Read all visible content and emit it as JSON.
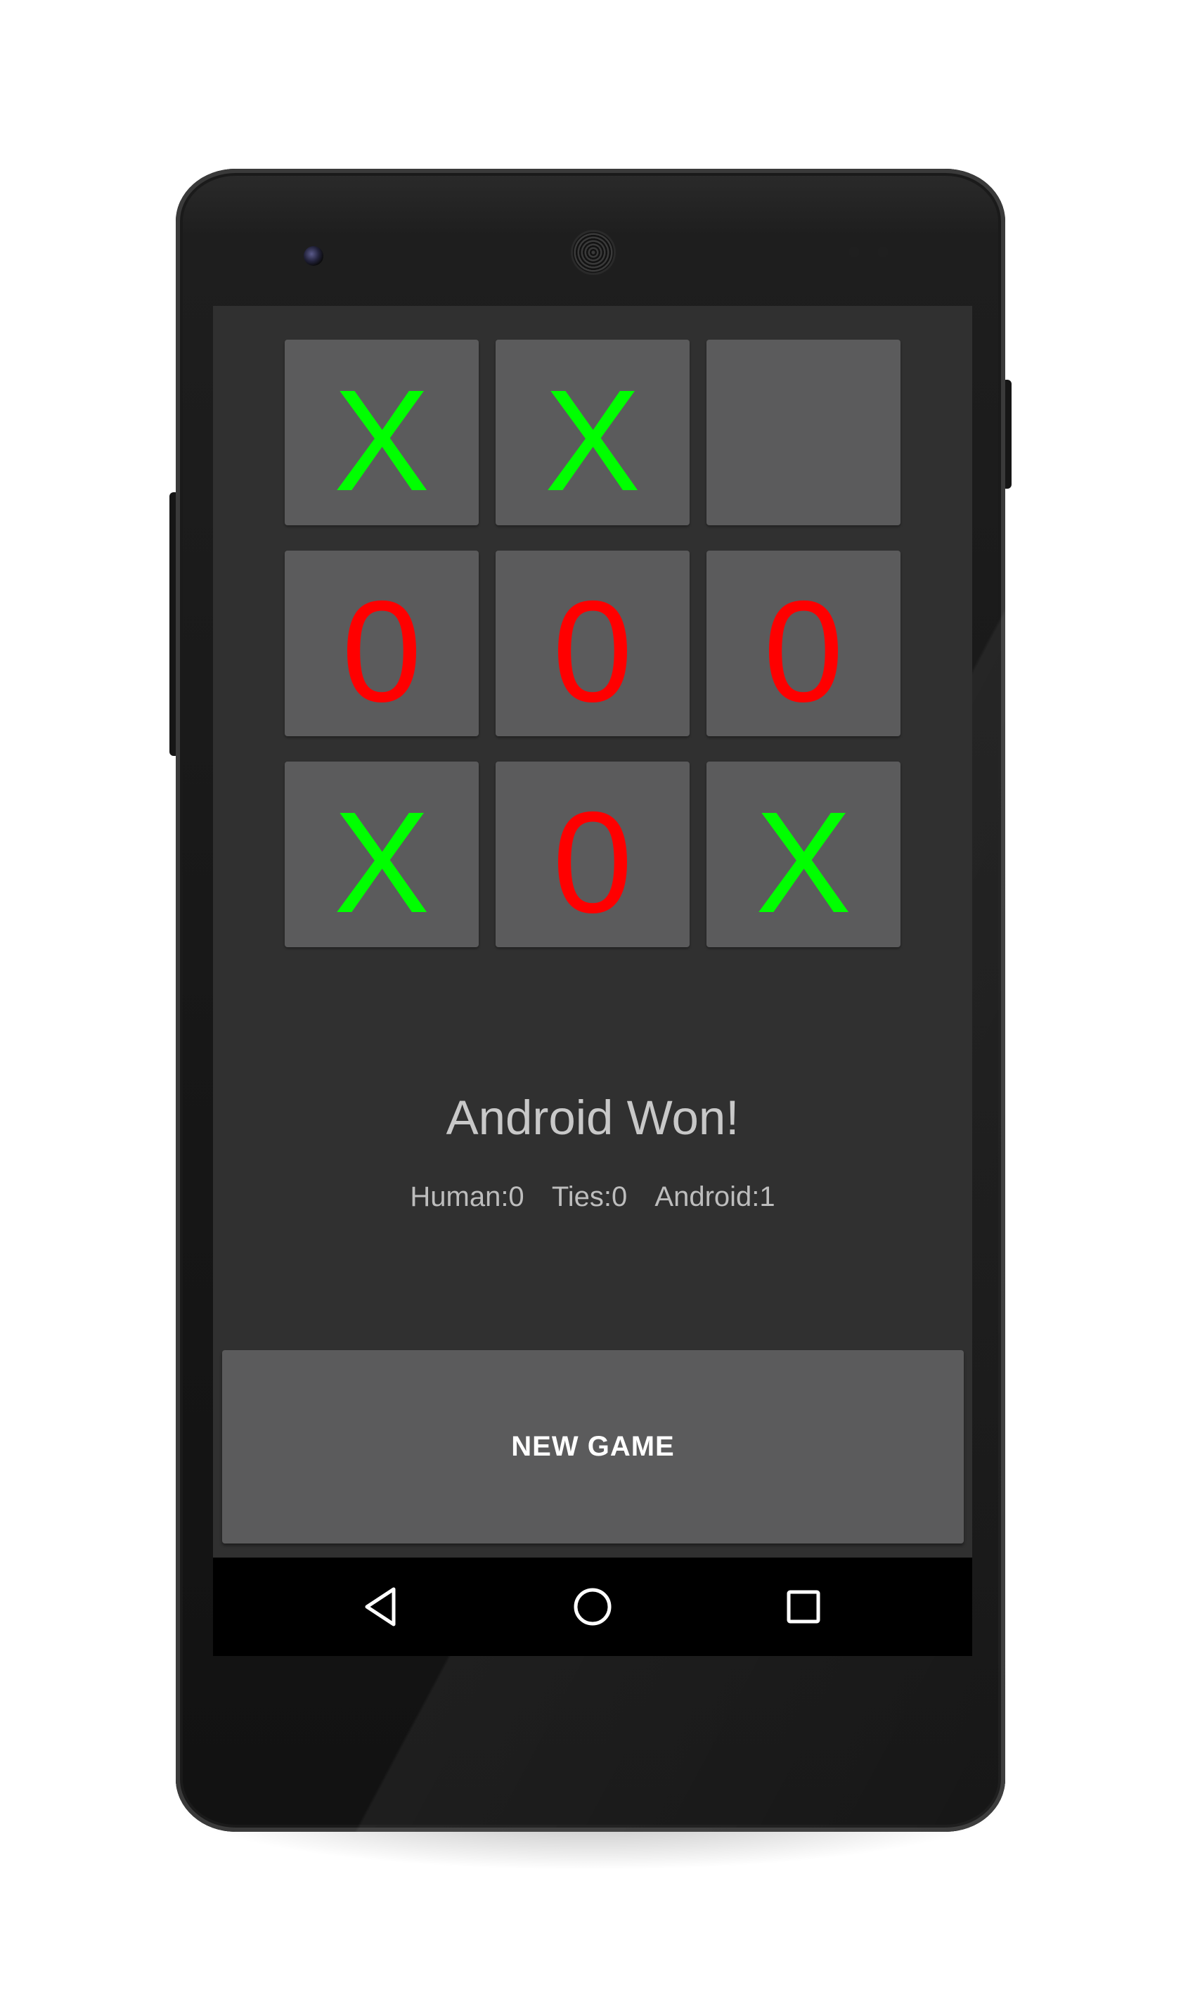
{
  "board": {
    "cells": [
      {
        "mark": "X",
        "type": "x"
      },
      {
        "mark": "X",
        "type": "x"
      },
      {
        "mark": "",
        "type": "empty"
      },
      {
        "mark": "0",
        "type": "o"
      },
      {
        "mark": "0",
        "type": "o"
      },
      {
        "mark": "0",
        "type": "o"
      },
      {
        "mark": "X",
        "type": "x"
      },
      {
        "mark": "0",
        "type": "o"
      },
      {
        "mark": "X",
        "type": "x"
      }
    ],
    "colors": {
      "x": "#00ff00",
      "o": "#ff0000",
      "cell": "#5b5b5c"
    }
  },
  "status": {
    "message": "Android Won!"
  },
  "scores": {
    "human": "Human:0",
    "ties": "Ties:0",
    "android": "Android:1"
  },
  "controls": {
    "new_game_label": "NEW GAME"
  },
  "navbar": {
    "back_icon": "back-triangle",
    "home_icon": "home-circle",
    "recents_icon": "recents-square"
  }
}
